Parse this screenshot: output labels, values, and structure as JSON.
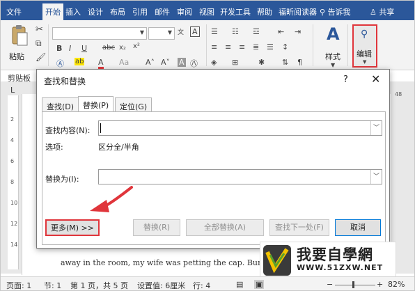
{
  "ribbon_tabs": [
    "文件",
    "开始",
    "插入",
    "设计",
    "布局",
    "引用",
    "邮件",
    "审阅",
    "视图",
    "开发工具",
    "帮助",
    "福昕阅读器"
  ],
  "active_tab": "开始",
  "tell_me": "告诉我",
  "share": "共享",
  "ribbon": {
    "paste_label": "粘贴",
    "clipboard_group": "剪贴板",
    "styles_label": "样式",
    "editing_label": "编辑",
    "bold": "B",
    "italic": "I",
    "underline": "U",
    "strike": "abc",
    "subscript": "x₂",
    "superscript": "x²"
  },
  "dialog": {
    "title": "查找和替换",
    "help": "?",
    "close": "✕",
    "tabs": [
      "查找(D)",
      "替换(P)",
      "定位(G)"
    ],
    "active_tab": "替换(P)",
    "find_label": "查找内容(N):",
    "find_value": "",
    "options_label": "选项:",
    "options_value": "区分全/半角",
    "replace_label": "替换为(I):",
    "replace_value": "",
    "buttons": {
      "more": "更多(M) >>",
      "replace": "替换(R)",
      "replace_all": "全部替换(A)",
      "find_next": "查找下一处(F)",
      "cancel": "取消"
    }
  },
  "document_text": "away in the room, my wife was petting the cap. Bun en c",
  "ruler_number": "48",
  "watermark": {
    "title": "我要自學網",
    "url": "WWW.51ZXW.NET"
  },
  "statusbar": {
    "page": "页面: 1",
    "section": "节: 1",
    "page_of": "第 1 页，共 5 页",
    "position": "设置值: 6厘米",
    "line": "行: 4",
    "zoom": "82%"
  },
  "colors": {
    "ribbon_blue": "#2b579a",
    "highlight_red": "#e0353b"
  }
}
